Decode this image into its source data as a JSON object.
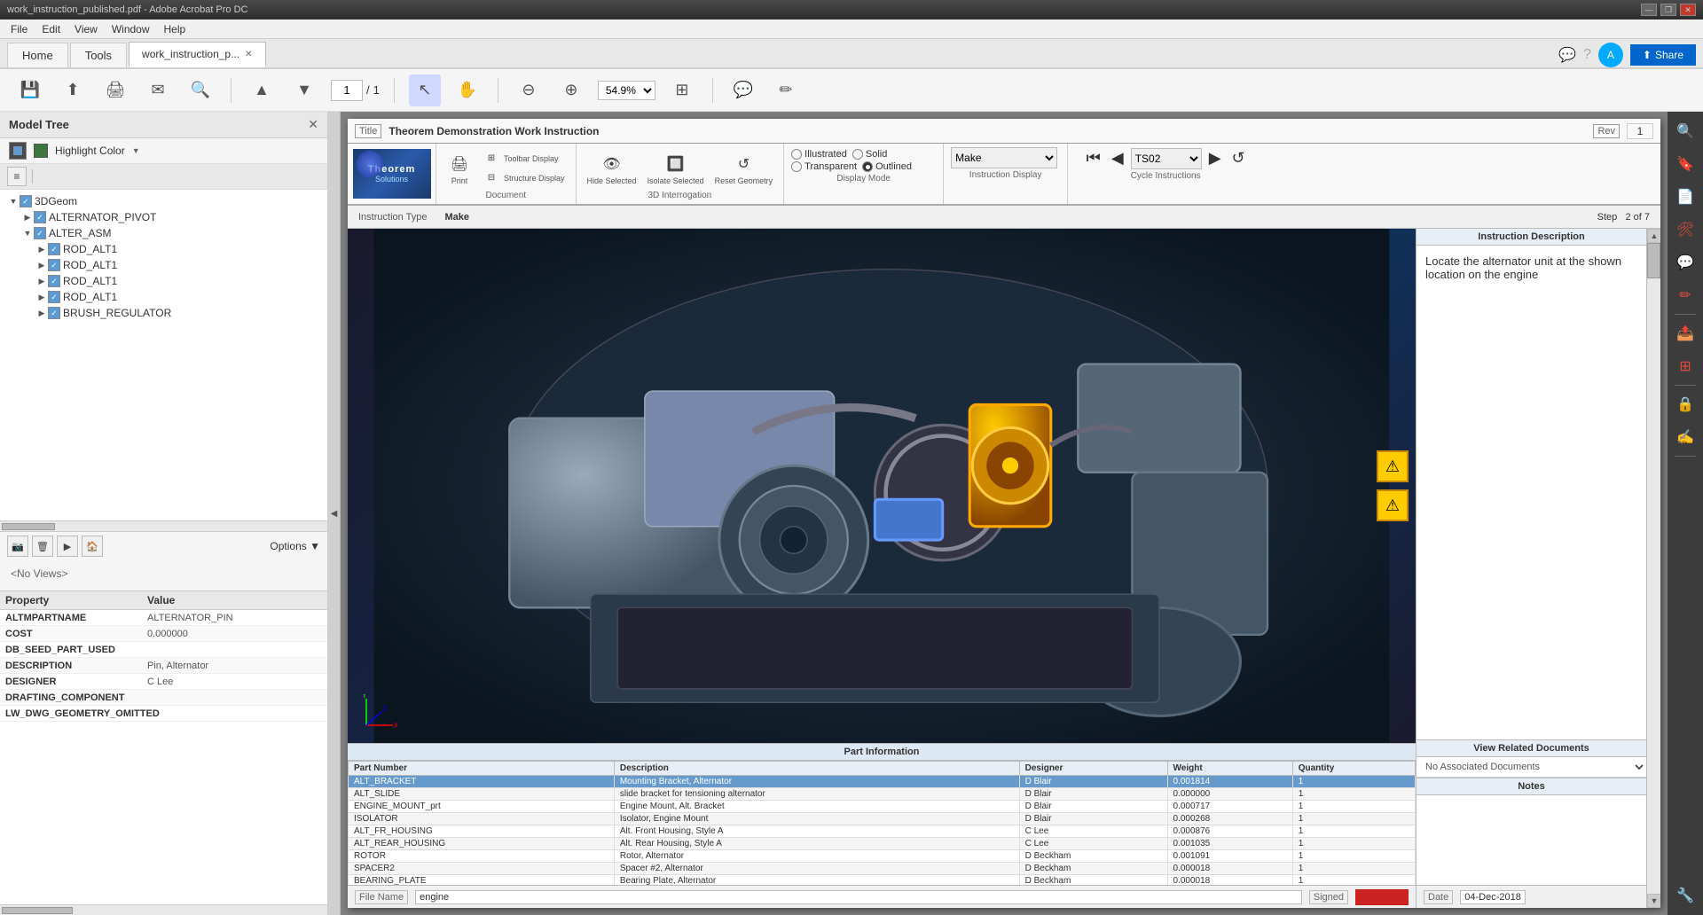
{
  "titlebar": {
    "text": "work_instruction_published.pdf - Adobe Acrobat Pro DC",
    "min": "—",
    "restore": "❐",
    "close": "✕"
  },
  "menubar": {
    "items": [
      "File",
      "Edit",
      "View",
      "Window",
      "Help"
    ]
  },
  "tabs": {
    "home": "Home",
    "tools": "Tools",
    "doc": "work_instruction_p...",
    "share": "Share"
  },
  "toolbar": {
    "page_current": "1",
    "page_total": "1",
    "zoom": "54.9%"
  },
  "left_panel": {
    "title": "Model Tree",
    "highlight_color": "Highlight Color",
    "tree": {
      "root": "3DGeom",
      "items": [
        {
          "label": "ALTERNATOR_PIVOT",
          "level": 1,
          "checked": true,
          "expanded": false
        },
        {
          "label": "ALTER_ASM",
          "level": 1,
          "checked": true,
          "expanded": true
        },
        {
          "label": "ROD_ALT1",
          "level": 2,
          "checked": true,
          "expanded": false
        },
        {
          "label": "ROD_ALT1",
          "level": 2,
          "checked": true,
          "expanded": false
        },
        {
          "label": "ROD_ALT1",
          "level": 2,
          "checked": true,
          "expanded": false
        },
        {
          "label": "ROD_ALT1",
          "level": 2,
          "checked": true,
          "expanded": false
        },
        {
          "label": "BRUSH_REGULATOR",
          "level": 2,
          "checked": true,
          "expanded": false
        }
      ]
    },
    "no_views": "<No Views>",
    "options": "Options",
    "properties": {
      "header": {
        "col1": "Property",
        "col2": "Value"
      },
      "rows": [
        {
          "prop": "ALTMPARTNAME",
          "val": "ALTERNATOR_PIN"
        },
        {
          "prop": "COST",
          "val": "0.000000"
        },
        {
          "prop": "DB_SEED_PART_USED",
          "val": ""
        },
        {
          "prop": "DESCRIPTION",
          "val": "Pin, Alternator"
        },
        {
          "prop": "DESIGNER",
          "val": "C Lee"
        },
        {
          "prop": "DRAFTING_COMPONENT",
          "val": ""
        },
        {
          "prop": "LW_DWG_GEOMETRY_OMITTED",
          "val": ""
        }
      ]
    }
  },
  "pdf": {
    "title_label": "Title",
    "title_value": "Theorem Demonstration Work Instruction",
    "rev_label": "Rev",
    "rev_value": "1",
    "toolbar": {
      "print": "Print",
      "toolbar_display": "Toolbar Display",
      "structure_display": "Structure Display",
      "hide_selected": "Hide Selected",
      "isolate_selected": "Isolate Selected",
      "reset_geometry": "Reset Geometry",
      "document_label": "Document",
      "interrogation_label": "3D Interrogation",
      "display_illustrated": "Illustrated",
      "display_solid": "Solid",
      "display_transparent": "Transparent",
      "display_outlined": "Outlined",
      "display_mode_label": "Display Mode",
      "make_option": "Make",
      "instruction_display_label": "Instruction Display",
      "cycle_instructions_label": "Cycle Instructions",
      "cycle_ts02": "TS02"
    },
    "instruction_info": {
      "type_label": "Instruction Type",
      "type_value": "Make",
      "step_label": "Step",
      "step_value": "2 of 7"
    },
    "description": {
      "header": "Instruction Description",
      "text": "Locate the alternator unit at the shown location on the engine"
    },
    "related_docs": {
      "header": "View Related Documents",
      "no_docs": "No Associated Documents"
    },
    "notes": {
      "header": "Notes",
      "content": ""
    },
    "part_table": {
      "header": "Part Information",
      "columns": [
        "Part Number",
        "Description",
        "Designer",
        "Weight",
        "Quantity"
      ],
      "rows": [
        {
          "part": "ALT_BRACKET",
          "desc": "Mounting Bracket, Alternator",
          "designer": "D Blair",
          "weight": "0.001814",
          "qty": "1",
          "highlight": true
        },
        {
          "part": "ALT_SLIDE",
          "desc": "slide bracket for tensioning alternator",
          "designer": "D Blair",
          "weight": "0.000000",
          "qty": "1"
        },
        {
          "part": "ENGINE_MOUNT_prt",
          "desc": "Engine Mount, Alt. Bracket",
          "designer": "D Blair",
          "weight": "0.000717",
          "qty": "1"
        },
        {
          "part": "ISOLATOR",
          "desc": "Isolator, Engine Mount",
          "designer": "D Blair",
          "weight": "0.000268",
          "qty": "1"
        },
        {
          "part": "ALT_FR_HOUSING",
          "desc": "Alt. Front Housing, Style A",
          "designer": "C Lee",
          "weight": "0.000876",
          "qty": "1"
        },
        {
          "part": "ALT_REAR_HOUSING",
          "desc": "Alt. Rear Housing, Style A",
          "designer": "C Lee",
          "weight": "0.001035",
          "qty": "1"
        },
        {
          "part": "ROTOR",
          "desc": "Rotor, Alternator",
          "designer": "D Beckham",
          "weight": "0.001091",
          "qty": "1"
        },
        {
          "part": "SPACER2",
          "desc": "Spacer #2, Alternator",
          "designer": "D Beckham",
          "weight": "0.000018",
          "qty": "1"
        },
        {
          "part": "BEARING_PLATE",
          "desc": "Bearing Plate, Alternator",
          "designer": "D Beckham",
          "weight": "0.000018",
          "qty": "1"
        }
      ]
    },
    "file_info": {
      "file_label": "File Name",
      "file_value": "engine",
      "signed_label": "Signed"
    },
    "date_info": {
      "date_label": "Date",
      "date_value": "04-Dec-2018"
    }
  }
}
